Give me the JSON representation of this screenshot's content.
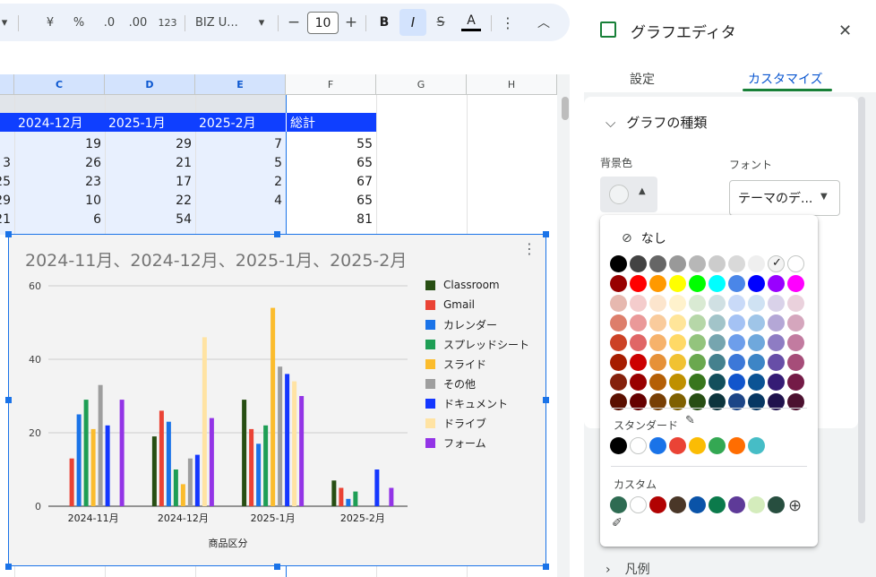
{
  "toolbar": {
    "currency": "¥",
    "percent": "%",
    "dec_decrease": ".0",
    "dec_increase": ".00",
    "number_format": "123",
    "font_name": "BIZ U...",
    "font_size": "10",
    "bold": "B",
    "italic": "I",
    "strike": "S",
    "text_color": "A"
  },
  "grid": {
    "columns": [
      "C",
      "D",
      "E",
      "F",
      "G",
      "H"
    ],
    "header_row": [
      "2024-12月",
      "2025-1月",
      "2025-2月",
      "総計"
    ],
    "rows": [
      {
        "b": "",
        "c": "19",
        "d": "29",
        "e": "7",
        "f": "55"
      },
      {
        "b": "3",
        "c": "26",
        "d": "21",
        "e": "5",
        "f": "65"
      },
      {
        "b": "25",
        "c": "23",
        "d": "17",
        "e": "2",
        "f": "67"
      },
      {
        "b": "29",
        "c": "10",
        "d": "22",
        "e": "4",
        "f": "65"
      },
      {
        "b": "21",
        "c": "6",
        "d": "54",
        "e": "",
        "f": "81"
      }
    ]
  },
  "chart_data": {
    "type": "bar",
    "title": "2024-11月、2024-12月、2025-1月、2025-2月",
    "xlabel": "商品区分",
    "ylabel": "",
    "ylim": [
      0,
      60
    ],
    "yticks": [
      "0",
      "20",
      "40",
      "60"
    ],
    "categories": [
      "2024-11月",
      "2024-12月",
      "2025-1月",
      "2025-2月"
    ],
    "series": [
      {
        "name": "Classroom",
        "color": "#274e13",
        "values": [
          0,
          19,
          29,
          7
        ]
      },
      {
        "name": "Gmail",
        "color": "#ea4335",
        "values": [
          13,
          26,
          21,
          5
        ]
      },
      {
        "name": "カレンダー",
        "color": "#1a73e8",
        "values": [
          25,
          23,
          17,
          2
        ]
      },
      {
        "name": "スプレッドシート",
        "color": "#1e9e55",
        "values": [
          29,
          10,
          22,
          4
        ]
      },
      {
        "name": "スライド",
        "color": "#fbbc2d",
        "values": [
          21,
          6,
          54,
          0
        ]
      },
      {
        "name": "その他",
        "color": "#9e9e9e",
        "values": [
          33,
          13,
          38,
          0
        ]
      },
      {
        "name": "ドキュメント",
        "color": "#1437ff",
        "values": [
          22,
          14,
          36,
          10
        ]
      },
      {
        "name": "ドライブ",
        "color": "#ffe3a3",
        "values": [
          0,
          46,
          34,
          0
        ]
      },
      {
        "name": "フォーム",
        "color": "#9334e6",
        "values": [
          29,
          24,
          30,
          5
        ]
      }
    ],
    "legend_position": "right",
    "grid": true
  },
  "panel": {
    "title": "グラフエディタ",
    "tabs": [
      "設定",
      "カスタマイズ"
    ],
    "active_tab": "カスタマイズ",
    "section_chart_type": "グラフの種類",
    "bg_label": "背景色",
    "font_label": "フォント",
    "font_value": "テーマのデ...",
    "legend_section": "凡例"
  },
  "picker": {
    "none_label": "なし",
    "standard_label": "スタンダード",
    "custom_label": "カスタム",
    "palette": [
      [
        "#000000",
        "#434343",
        "#666666",
        "#999999",
        "#b7b7b7",
        "#cccccc",
        "#d9d9d9",
        "#efefef",
        "#f3f3f3",
        "#ffffff"
      ],
      [
        "#980000",
        "#ff0000",
        "#ff9900",
        "#ffff00",
        "#00ff00",
        "#00ffff",
        "#4a86e8",
        "#0000ff",
        "#9900ff",
        "#ff00ff"
      ],
      [
        "#e6b8af",
        "#f4cccc",
        "#fce5cd",
        "#fff2cc",
        "#d9ead3",
        "#d0e0e3",
        "#c9daf8",
        "#cfe2f3",
        "#d9d2e9",
        "#ead1dc"
      ],
      [
        "#dd7e6b",
        "#ea9999",
        "#f9cb9c",
        "#ffe599",
        "#b6d7a8",
        "#a2c4c9",
        "#a4c2f4",
        "#9fc5e8",
        "#b4a7d6",
        "#d5a6bd"
      ],
      [
        "#cc4125",
        "#e06666",
        "#f6b26b",
        "#ffd966",
        "#93c47d",
        "#76a5af",
        "#6d9eeb",
        "#6fa8dc",
        "#8e7cc3",
        "#c27ba0"
      ],
      [
        "#a61c00",
        "#cc0000",
        "#e69138",
        "#f1c232",
        "#6aa84f",
        "#45818e",
        "#3c78d8",
        "#3d85c6",
        "#674ea7",
        "#a64d79"
      ],
      [
        "#85200c",
        "#990000",
        "#b45f06",
        "#bf9000",
        "#38761d",
        "#134f5c",
        "#1155cc",
        "#0b5394",
        "#351c75",
        "#741b47"
      ],
      [
        "#5b0f00",
        "#660000",
        "#783f04",
        "#7f6000",
        "#274e13",
        "#0c343d",
        "#1c4587",
        "#073763",
        "#20124d",
        "#4c1130"
      ]
    ],
    "selected": "#f3f3f3",
    "standard": [
      "#000000",
      "#ffffff",
      "#1a73e8",
      "#ea4335",
      "#fbbc04",
      "#34a853",
      "#ff6d01",
      "#46bdc6"
    ],
    "custom": [
      "#2e6b52",
      "#ffffff",
      "#b10202",
      "#4a3728",
      "#0a53a8",
      "#0b7a4b",
      "#5e3a98",
      "#d4ecbc",
      "#274e3f"
    ]
  }
}
